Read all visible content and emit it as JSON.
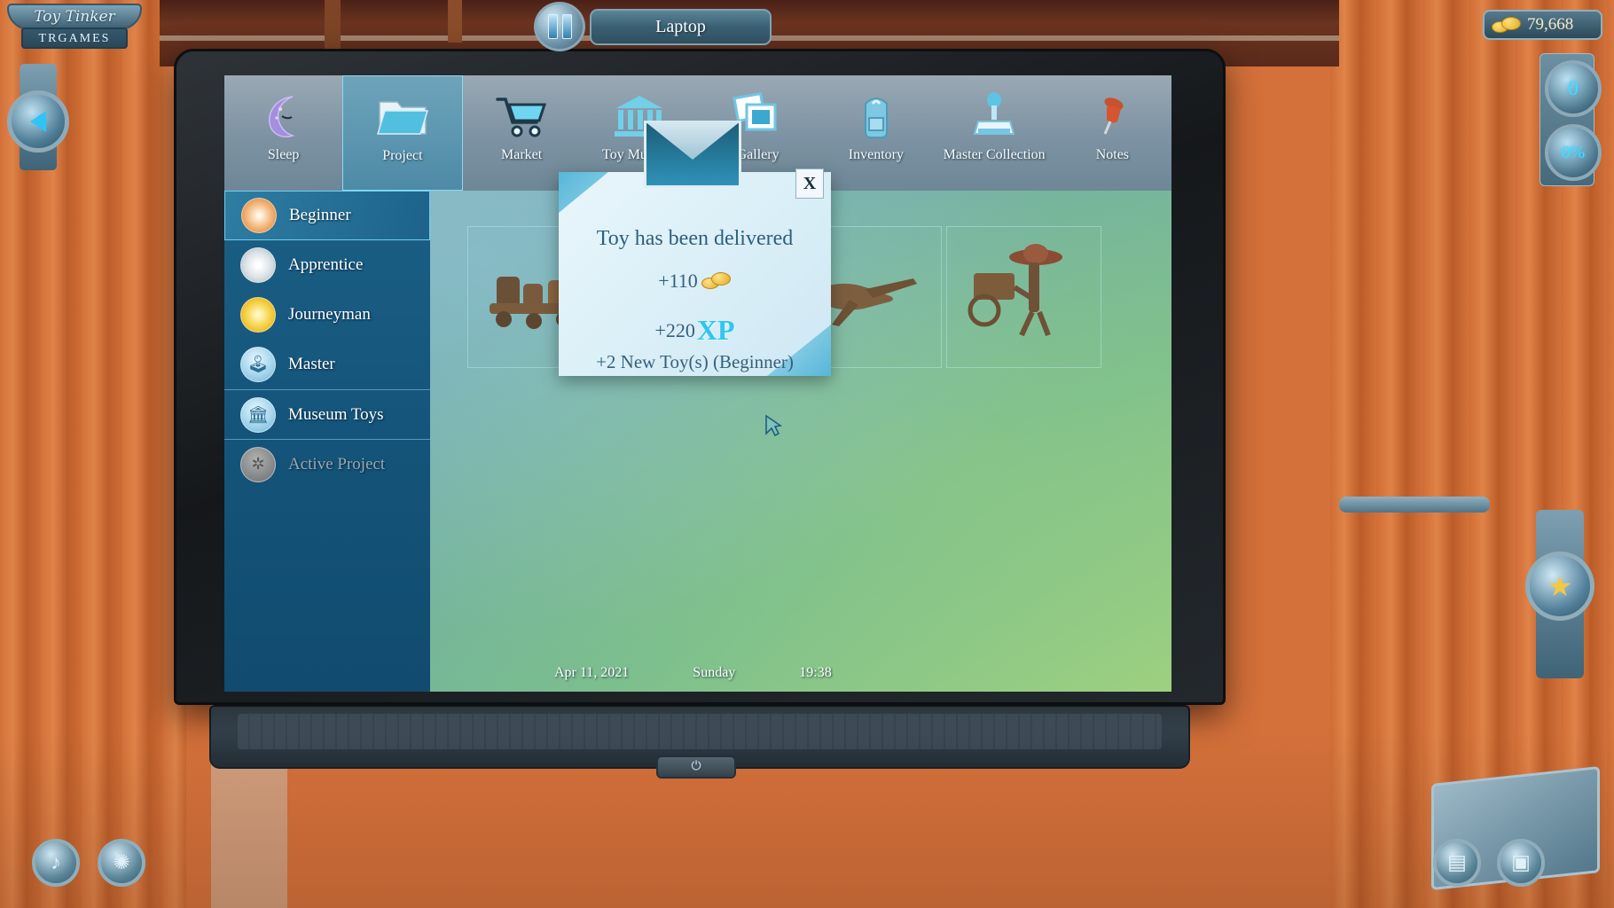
{
  "brand": {
    "name": "Toy Tinker",
    "studio": "TRGAMES"
  },
  "titlebar": {
    "title": "Laptop",
    "pause_icon": "pause-icon"
  },
  "hud": {
    "coins_label": "79,668",
    "coin_icon": "coin-stack-icon",
    "gauge_top": "0",
    "gauge_bottom": "0%",
    "left_dial_icon": "play-triangle-icon",
    "star_icon": "★"
  },
  "desk_buttons": [
    {
      "name": "music-button",
      "icon": "♪"
    },
    {
      "name": "palette-button",
      "icon": "✺"
    },
    {
      "name": "book-button",
      "icon": "▤"
    },
    {
      "name": "camera-button",
      "icon": "▣"
    }
  ],
  "nav": {
    "items": [
      {
        "label": "Sleep",
        "icon": "moon-icon",
        "selected": false
      },
      {
        "label": "Project",
        "icon": "folder-icon",
        "selected": true
      },
      {
        "label": "Market",
        "icon": "shopping-cart-icon",
        "selected": false
      },
      {
        "label": "Toy Museum",
        "icon": "museum-icon",
        "selected": false
      },
      {
        "label": "Gallery",
        "icon": "photos-icon",
        "selected": false
      },
      {
        "label": "Inventory",
        "icon": "backpack-icon",
        "selected": false
      },
      {
        "label": "Master Collection",
        "icon": "joystick-icon",
        "selected": false
      },
      {
        "label": "Notes",
        "icon": "pushpin-icon",
        "selected": false
      }
    ]
  },
  "sidebar": {
    "items": [
      {
        "label": "Beginner",
        "icon": "orange-orb-icon",
        "selected": true,
        "disabled": false,
        "divider": false
      },
      {
        "label": "Apprentice",
        "icon": "silver-orb-icon",
        "selected": false,
        "disabled": false,
        "divider": false
      },
      {
        "label": "Journeyman",
        "icon": "gold-orb-icon",
        "selected": false,
        "disabled": false,
        "divider": false
      },
      {
        "label": "Master",
        "icon": "joystick-orb-icon",
        "selected": false,
        "disabled": false,
        "divider": false
      },
      {
        "label": "Museum Toys",
        "icon": "museum-orb-icon",
        "selected": false,
        "disabled": false,
        "divider": true
      },
      {
        "label": "Active Project",
        "icon": "disabled-orb-icon",
        "selected": false,
        "disabled": true,
        "divider": true
      }
    ]
  },
  "popup": {
    "close_label": "X",
    "envelope_icon": "envelope-icon",
    "title": "Toy has been delivered",
    "coins_reward": "+110",
    "coin_icon": "coin-stack-icon",
    "xp_amount": "+220",
    "xp_label": "XP",
    "toys_line": "+2 New Toy(s) (Beginner)"
  },
  "statusbar": {
    "date": "Apr 11, 2021",
    "weekday": "Sunday",
    "time": "19:38"
  },
  "cursor": {
    "icon": "arrow-cursor-icon"
  },
  "colors": {
    "accent_cyan": "#2fc6f0",
    "nav_selected": "#4d8aa6",
    "sidebar_bg": "#15557b",
    "desk_orange": "#cf6f36"
  }
}
